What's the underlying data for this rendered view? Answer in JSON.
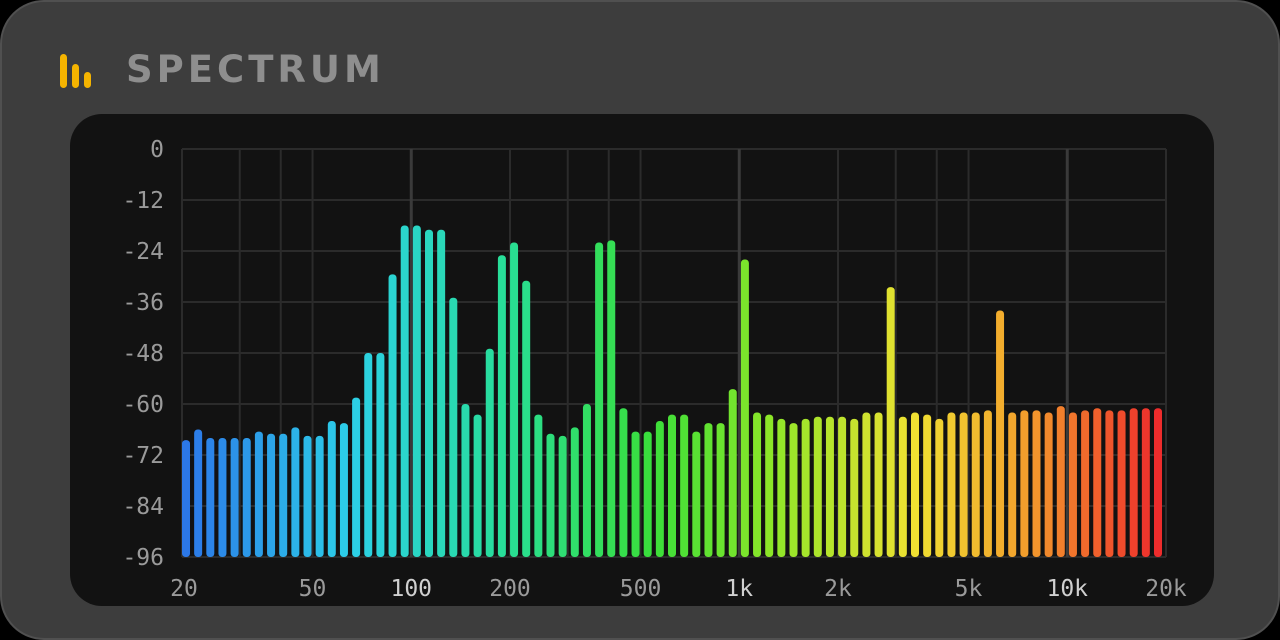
{
  "header": {
    "title": "SPECTRUM",
    "logo_icon": "bar-chart-icon"
  },
  "colors": {
    "logo": "#f5b400",
    "title": "#8e8e8e",
    "grid": "#2b2b2b",
    "grid_major": "#3a3a3a",
    "tick": "#9a9a9a",
    "tick_major": "#d0d0d0"
  },
  "chart_data": {
    "type": "bar",
    "title": "SPECTRUM",
    "xlabel": "",
    "ylabel": "",
    "x_scale": "log",
    "xlim": [
      20,
      20000
    ],
    "ylim": [
      -96,
      0
    ],
    "grid": true,
    "legend": "none",
    "y_ticks": [
      "0",
      "-12",
      "-24",
      "-36",
      "-48",
      "-60",
      "-72",
      "-84",
      "-96"
    ],
    "x_ticks": [
      {
        "value": 20,
        "label": "20",
        "major": false
      },
      {
        "value": 50,
        "label": "50",
        "major": false
      },
      {
        "value": 100,
        "label": "100",
        "major": true
      },
      {
        "value": 200,
        "label": "200",
        "major": false
      },
      {
        "value": 500,
        "label": "500",
        "major": false
      },
      {
        "value": 1000,
        "label": "1k",
        "major": true
      },
      {
        "value": 2000,
        "label": "2k",
        "major": false
      },
      {
        "value": 5000,
        "label": "5k",
        "major": false
      },
      {
        "value": 10000,
        "label": "10k",
        "major": true
      },
      {
        "value": 20000,
        "label": "20k",
        "major": false
      }
    ],
    "x_grid": [
      20,
      30,
      40,
      50,
      100,
      200,
      300,
      400,
      500,
      1000,
      2000,
      3000,
      4000,
      5000,
      10000,
      20000
    ],
    "y_grid": [
      0,
      -12,
      -24,
      -36,
      -48,
      -60,
      -72,
      -84,
      -96
    ],
    "color_scale": "blue-to-red across frequency",
    "values": [
      -68.5,
      -66,
      -68,
      -68,
      -68,
      -68,
      -66.5,
      -67,
      -67,
      -65.5,
      -67.5,
      -67.5,
      -64,
      -64.5,
      -58.5,
      -48,
      -48,
      -29.5,
      -18,
      -18,
      -19,
      -19,
      -35,
      -60,
      -62.5,
      -47,
      -25,
      -22,
      -31,
      -62.5,
      -67,
      -67.5,
      -65.5,
      -60,
      -22,
      -21.5,
      -61,
      -66.5,
      -66.5,
      -64,
      -62.5,
      -62.5,
      -66.5,
      -64.5,
      -64.5,
      -56.5,
      -26,
      -62,
      -62.5,
      -63.5,
      -64.5,
      -63.5,
      -63,
      -63,
      -63,
      -63.5,
      -62,
      -62,
      -32.5,
      -63,
      -62,
      -62.5,
      -63.5,
      -62,
      -62,
      -62,
      -61.5,
      -38,
      -62,
      -61.5,
      -61.5,
      -62,
      -60.5,
      -62,
      -61.5,
      -61,
      -61.5,
      -61.5,
      -61,
      -61,
      -61
    ]
  }
}
